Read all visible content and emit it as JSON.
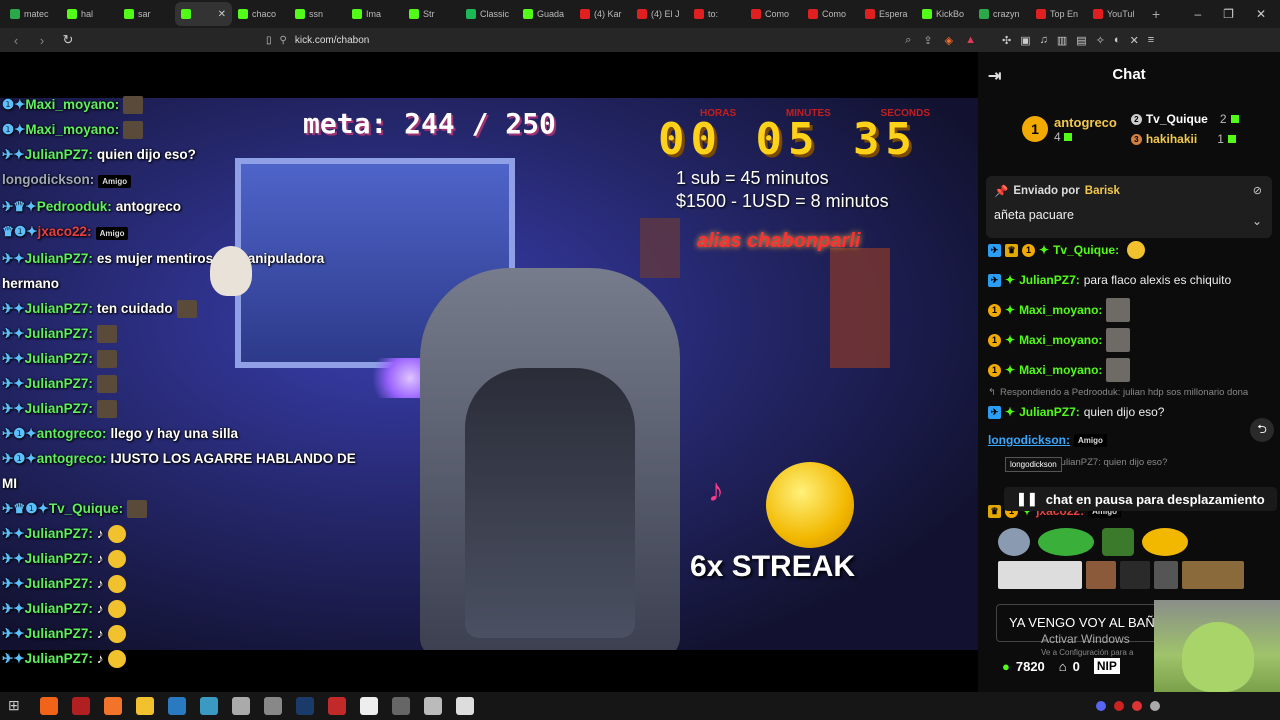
{
  "browser": {
    "tabs": [
      {
        "title": "matec",
        "color": "#2aa84a"
      },
      {
        "title": "hal",
        "color": "#53fc18"
      },
      {
        "title": "sar",
        "color": "#53fc18"
      },
      {
        "title": "",
        "color": "#53fc18",
        "active": true
      },
      {
        "title": "chaco",
        "color": "#53fc18"
      },
      {
        "title": "ssn",
        "color": "#53fc18"
      },
      {
        "title": "Ima",
        "color": "#53fc18"
      },
      {
        "title": "Str",
        "color": "#53fc18"
      },
      {
        "title": "Classic",
        "color": "#1db954"
      },
      {
        "title": "Guada",
        "color": "#53fc18"
      },
      {
        "title": "(4) Kar",
        "color": "#e02020"
      },
      {
        "title": "(4) El J",
        "color": "#e02020"
      },
      {
        "title": "to:",
        "color": "#e02020"
      },
      {
        "title": "Como",
        "color": "#e02020"
      },
      {
        "title": "Como",
        "color": "#e02020"
      },
      {
        "title": "Espera",
        "color": "#e02020"
      },
      {
        "title": "KickBo",
        "color": "#53fc18"
      },
      {
        "title": "crazyn",
        "color": "#2aa84a"
      },
      {
        "title": "Top En",
        "color": "#e02020"
      },
      {
        "title": "YouTul",
        "color": "#e02020"
      }
    ],
    "new_tab": "+",
    "window_controls": [
      "–",
      "❐",
      "✕"
    ],
    "url": "kick.com/chabon"
  },
  "stream": {
    "meta": "meta: 244 / 250",
    "timer_labels": [
      "HORAS",
      "MINUTES",
      "SECONDS"
    ],
    "timer": "00 05 35",
    "rate_sub": "1 sub = 45 minutos",
    "rate_usd": "$1500 - 1USD = 8 minutos",
    "alias": "alias chabonparli",
    "streak": "6x STREAK",
    "overlay_chat": [
      {
        "user": "Maxi_moyano:",
        "cls": "u-green",
        "msg": "",
        "emote": "sq",
        "prefix": "❶✦"
      },
      {
        "user": "Maxi_moyano:",
        "cls": "u-green",
        "msg": "",
        "emote": "sq",
        "prefix": "❶✦"
      },
      {
        "user": "JulianPZ7:",
        "cls": "u-green",
        "msg": "quien dijo eso?",
        "emote": "",
        "prefix": "✈✦"
      },
      {
        "user": "longodickson:",
        "cls": "u-grey",
        "msg": "",
        "emote": "tag",
        "prefix": ""
      },
      {
        "user": "Pedrooduk:",
        "cls": "u-green",
        "msg": "antogreco",
        "emote": "",
        "prefix": "✈♛✦"
      },
      {
        "user": "jxaco22:",
        "cls": "u-red",
        "msg": "",
        "emote": "tag",
        "prefix": "♛❶✦"
      },
      {
        "user": "JulianPZ7:",
        "cls": "u-green",
        "msg": "es mujer mentirosa y manipuladora",
        "emote": "",
        "prefix": "✈✦"
      },
      {
        "user": "",
        "cls": "msg",
        "msg": "hermano",
        "emote": "",
        "prefix": ""
      },
      {
        "user": "JulianPZ7:",
        "cls": "u-green",
        "msg": "ten cuidado",
        "emote": "sq",
        "prefix": "✈✦"
      },
      {
        "user": "JulianPZ7:",
        "cls": "u-green",
        "msg": "",
        "emote": "sq",
        "prefix": "✈✦"
      },
      {
        "user": "JulianPZ7:",
        "cls": "u-green",
        "msg": "",
        "emote": "sq",
        "prefix": "✈✦"
      },
      {
        "user": "JulianPZ7:",
        "cls": "u-green",
        "msg": "",
        "emote": "sq",
        "prefix": "✈✦"
      },
      {
        "user": "JulianPZ7:",
        "cls": "u-green",
        "msg": "",
        "emote": "sq",
        "prefix": "✈✦"
      },
      {
        "user": "antogreco:",
        "cls": "u-green",
        "msg": "llego y hay una silla",
        "emote": "",
        "prefix": "✈❶✦"
      },
      {
        "user": "antogreco:",
        "cls": "u-green",
        "msg": "IJUSTO LOS AGARRE HABLANDO DE",
        "emote": "",
        "prefix": "✈❶✦"
      },
      {
        "user": "",
        "cls": "msg",
        "msg": "MI",
        "emote": "",
        "prefix": ""
      },
      {
        "user": "Tv_Quique:",
        "cls": "u-green",
        "msg": "",
        "emote": "sq",
        "prefix": "✈♛❶✦"
      },
      {
        "user": "JulianPZ7:",
        "cls": "u-green",
        "msg": "♪",
        "emote": "round",
        "prefix": "✈✦"
      },
      {
        "user": "JulianPZ7:",
        "cls": "u-green",
        "msg": "♪",
        "emote": "round",
        "prefix": "✈✦"
      },
      {
        "user": "JulianPZ7:",
        "cls": "u-green",
        "msg": "♪",
        "emote": "round",
        "prefix": "✈✦"
      },
      {
        "user": "JulianPZ7:",
        "cls": "u-green",
        "msg": "♪",
        "emote": "round",
        "prefix": "✈✦"
      },
      {
        "user": "JulianPZ7:",
        "cls": "u-green",
        "msg": "♪",
        "emote": "round",
        "prefix": "✈✦"
      },
      {
        "user": "JulianPZ7:",
        "cls": "u-green",
        "msg": "♪",
        "emote": "round",
        "prefix": "✈✦"
      }
    ]
  },
  "chat": {
    "title": "Chat",
    "leaderboard": {
      "first": {
        "rank": "1",
        "name": "antogreco",
        "count": "4"
      },
      "second": {
        "rank": "2",
        "name": "Tv_Quique",
        "count": "2"
      },
      "third": {
        "rank": "3",
        "name": "hakihakii",
        "count": "1"
      }
    },
    "pinned": {
      "sent_by_label": "Enviado por",
      "sent_by": "Barisk",
      "message": "añeta pacuare"
    },
    "messages": [
      {
        "user": "Tv_Quique:",
        "text": ""
      },
      {
        "user": "JulianPZ7:",
        "text": "para flaco alexis es chiquito"
      },
      {
        "user": "Maxi_moyano:",
        "text": ""
      },
      {
        "user": "Maxi_moyano:",
        "text": ""
      },
      {
        "user": "Maxi_moyano:",
        "text": ""
      },
      {
        "user": "JulianPZ7:",
        "text": "quien dijo eso?"
      },
      {
        "user": "longodickson:",
        "text": ""
      }
    ],
    "reply_1": "Respondiendo a Pedrooduk: julian hdp sos millonario dona",
    "reply_2": "a JulianPZ7: quien dijo eso?",
    "tag": "Amigo",
    "tooltip": "longodickson",
    "jxaco_user": "jxaco22:",
    "pause_label": "chat en pausa para desplazamiento",
    "input_value": "YA VENGO VOY AL BAÑO",
    "activate_title": "Activar Windows",
    "activate_sub": "Ve a Configuración para a",
    "kicks": "7820",
    "store": "0",
    "np_badge": "NIP"
  }
}
